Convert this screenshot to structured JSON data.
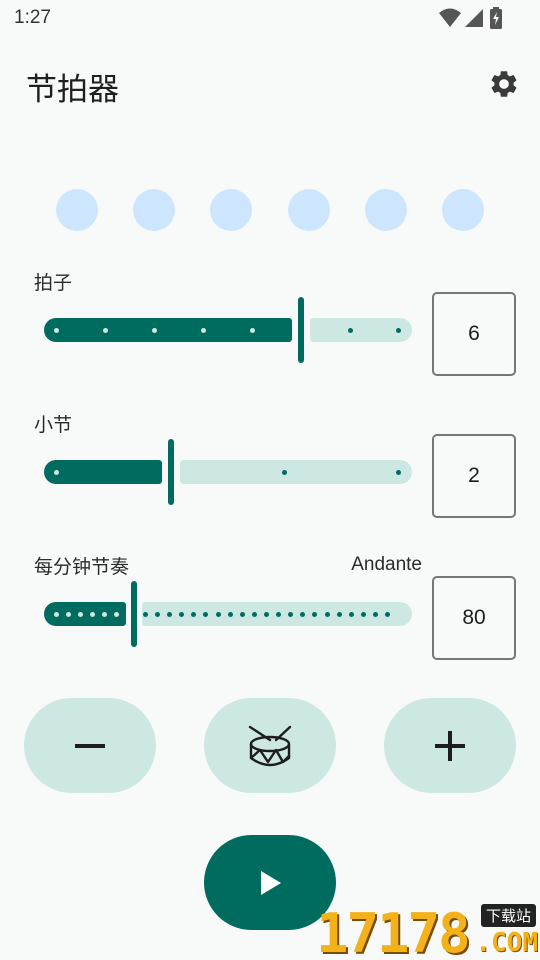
{
  "status_bar": {
    "time": "1:27",
    "icons": [
      "wifi-icon",
      "signal-icon",
      "battery-charging-icon"
    ]
  },
  "app": {
    "title": "节拍器",
    "settings_icon": "gear-icon"
  },
  "beat_indicators": {
    "count": 6,
    "color": "#cde6fd"
  },
  "beats_control": {
    "label": "拍子",
    "value": "6",
    "min": 1,
    "max": 8
  },
  "bars_control": {
    "label": "小节",
    "value": "2",
    "min": 1,
    "max": 3
  },
  "tempo_control": {
    "label": "每分钟节奏",
    "tempo_name": "Andante",
    "value": "80",
    "fraction": 0.24
  },
  "buttons": {
    "decrease_icon": "minus-icon",
    "drum_icon": "drum-icon",
    "increase_icon": "plus-icon",
    "play_icon": "play-icon"
  },
  "colors": {
    "accent": "#006c5f",
    "track_inactive": "#cde8e2",
    "background": "#f8faf9"
  },
  "watermark": {
    "number": "17178",
    "badge": "下载站",
    "suffix": ".COM"
  }
}
